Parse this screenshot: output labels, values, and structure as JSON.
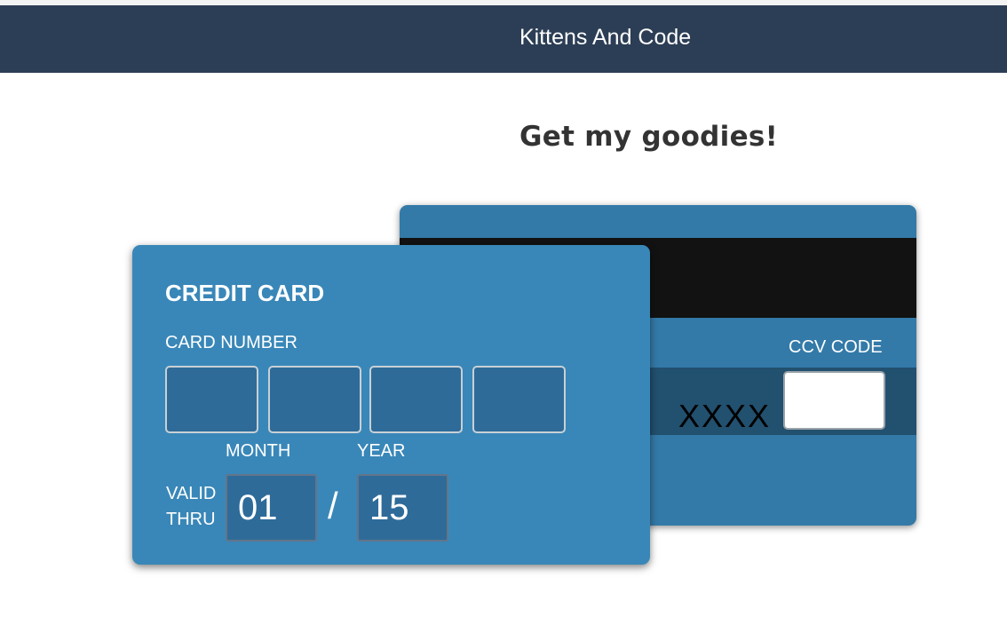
{
  "navbar": {
    "brand": "Kittens And Code"
  },
  "page": {
    "heading": "Get my goodies!"
  },
  "card_front": {
    "title": "CREDIT CARD",
    "card_number_label": "CARD NUMBER",
    "card_number_groups": [
      "",
      "",
      "",
      ""
    ],
    "month_label": "MONTH",
    "year_label": "YEAR",
    "valid_label_line1": "VALID",
    "valid_label_line2": "THRU",
    "month_value": "01",
    "separator": "/",
    "year_value": "15"
  },
  "card_back": {
    "ccv_label": "CCV CODE",
    "ccv_placeholder_text": "XXXX",
    "ccv_value": ""
  },
  "colors": {
    "navbar_bg": "#2c3e55",
    "card_front_bg": "#3987b8",
    "card_back_bg": "#337aa8",
    "stripe": "#121212",
    "input_bg": "#2e6b99"
  }
}
